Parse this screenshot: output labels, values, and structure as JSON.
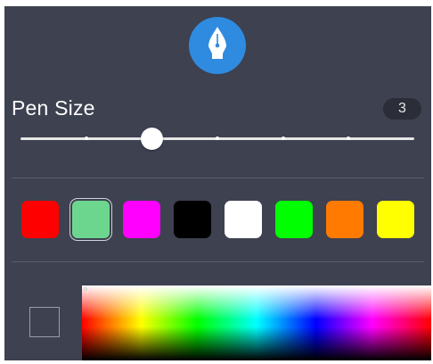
{
  "pen_settings": {
    "icon": "pen-nib-icon",
    "icon_background": "#2f8be0",
    "pen_size_label": "Pen Size",
    "pen_size_value": "3",
    "slider": {
      "min": 1,
      "max": 7,
      "value": 3,
      "tick_count": 7
    }
  },
  "palette": {
    "swatches": [
      {
        "name": "red",
        "color": "#ff0000",
        "selected": false
      },
      {
        "name": "light-green",
        "color": "#6dd68e",
        "selected": true
      },
      {
        "name": "magenta",
        "color": "#ff00ff",
        "selected": false
      },
      {
        "name": "black",
        "color": "#000000",
        "selected": false
      },
      {
        "name": "white",
        "color": "#ffffff",
        "selected": false
      },
      {
        "name": "green",
        "color": "#00ff00",
        "selected": false
      },
      {
        "name": "orange",
        "color": "#ff7a00",
        "selected": false
      },
      {
        "name": "yellow",
        "color": "#ffff00",
        "selected": false
      }
    ]
  },
  "custom_color": {
    "current": ""
  },
  "colors": {
    "panel_background": "#3d4150",
    "divider": "#5a5e6c",
    "accent": "#2f8be0"
  }
}
